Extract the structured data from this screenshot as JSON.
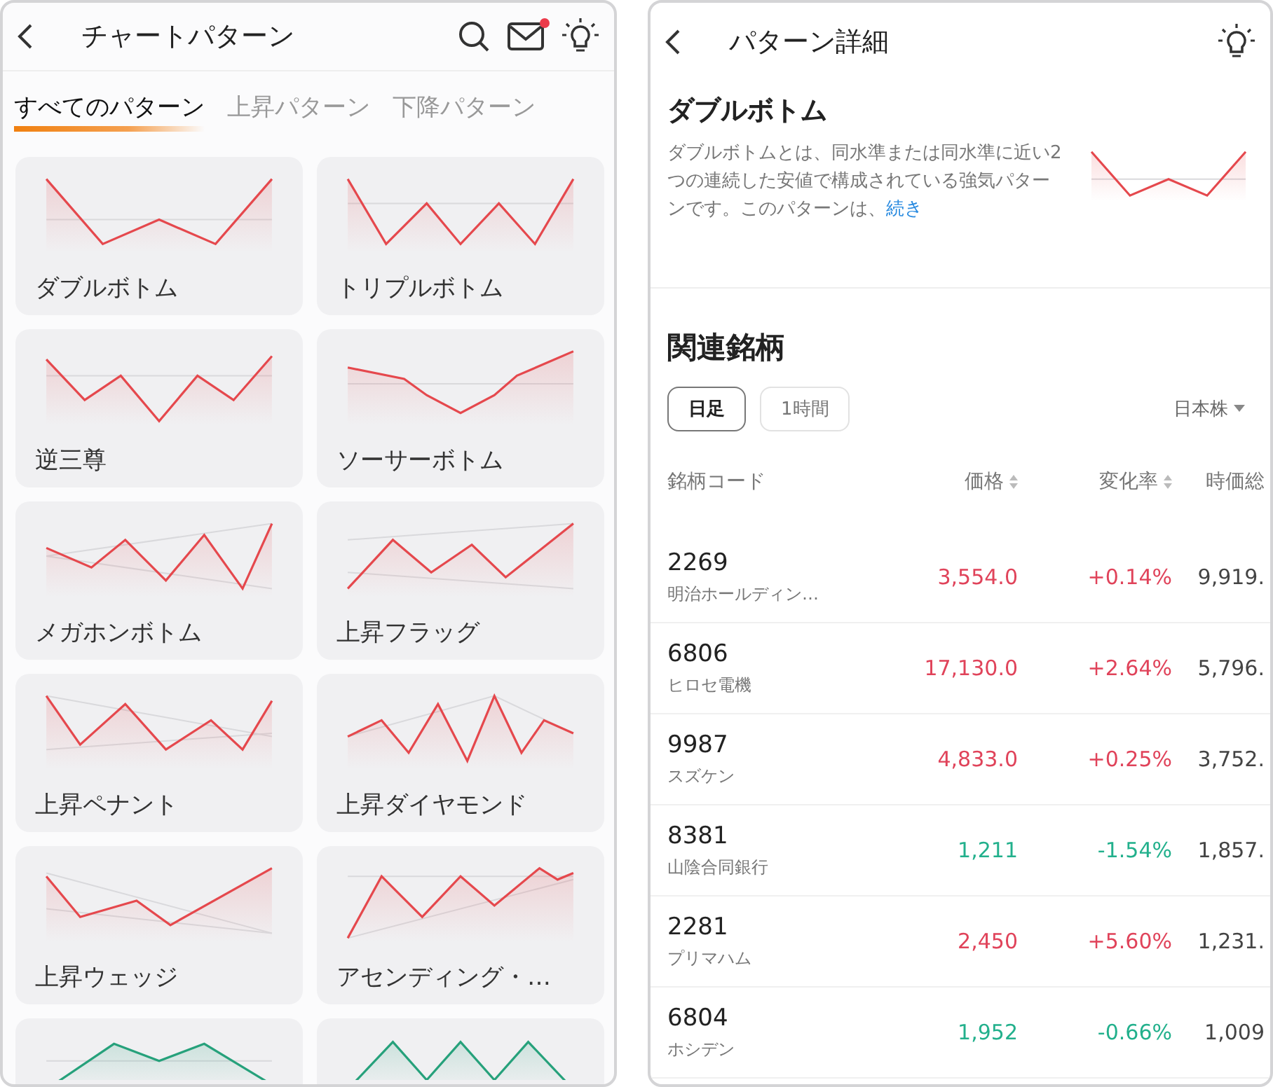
{
  "left_screen": {
    "header": {
      "title": "チャートパターン",
      "unread": true
    },
    "tabs": [
      {
        "label": "すべてのパターン",
        "selected": true
      },
      {
        "label": "上昇パターン",
        "selected": false
      },
      {
        "label": "下降パターン",
        "selected": false
      }
    ],
    "patterns": [
      {
        "label": "ダブルボトム",
        "color": "#e5484d"
      },
      {
        "label": "トリプルボトム",
        "color": "#e5484d"
      },
      {
        "label": "逆三尊",
        "color": "#e5484d"
      },
      {
        "label": "ソーサーボトム",
        "color": "#e5484d"
      },
      {
        "label": "メガホンボトム",
        "color": "#e5484d"
      },
      {
        "label": "上昇フラッグ",
        "color": "#e5484d"
      },
      {
        "label": "上昇ペナント",
        "color": "#e5484d"
      },
      {
        "label": "上昇ダイヤモンド",
        "color": "#e5484d"
      },
      {
        "label": "上昇ウェッジ",
        "color": "#e5484d"
      },
      {
        "label": "アセンディング・…",
        "color": "#e5484d"
      },
      {
        "color": "#26a17b"
      },
      {
        "color": "#26a17b"
      }
    ]
  },
  "right_screen": {
    "header": {
      "title": "パターン詳細"
    },
    "pattern": {
      "name": "ダブルボトム",
      "description": "ダブルボトムとは、同水準または同水準に近い2つの連続した安値で構成されている強気パターンです。このパターンは、",
      "more_link": "続き"
    },
    "section_title": "関連銘柄",
    "timeframes": [
      {
        "label": "日足",
        "selected": true
      },
      {
        "label": "1時間",
        "selected": false
      }
    ],
    "market": "日本株",
    "table": {
      "columns": [
        "銘柄コード",
        "価格",
        "変化率",
        "時価総"
      ],
      "rows": [
        {
          "code": "2269",
          "name": "明治ホールディン…",
          "price": "3,554.0",
          "change": "+0.14%",
          "market_cap": "9,919.",
          "color": "#e0435a"
        },
        {
          "code": "6806",
          "name": "ヒロセ電機",
          "price": "17,130.0",
          "change": "+2.64%",
          "market_cap": "5,796.",
          "color": "#e0435a"
        },
        {
          "code": "9987",
          "name": "スズケン",
          "price": "4,833.0",
          "change": "+0.25%",
          "market_cap": "3,752.",
          "color": "#e0435a"
        },
        {
          "code": "8381",
          "name": "山陰合同銀行",
          "price": "1,211",
          "change": "-1.54%",
          "market_cap": "1,857.",
          "color": "#22b08c"
        },
        {
          "code": "2281",
          "name": "プリマハム",
          "price": "2,450",
          "change": "+5.60%",
          "market_cap": "1,231.",
          "color": "#e0435a"
        },
        {
          "code": "6804",
          "name": "ホシデン",
          "price": "1,952",
          "change": "-0.66%",
          "market_cap": "1,009",
          "color": "#22b08c"
        }
      ]
    }
  }
}
